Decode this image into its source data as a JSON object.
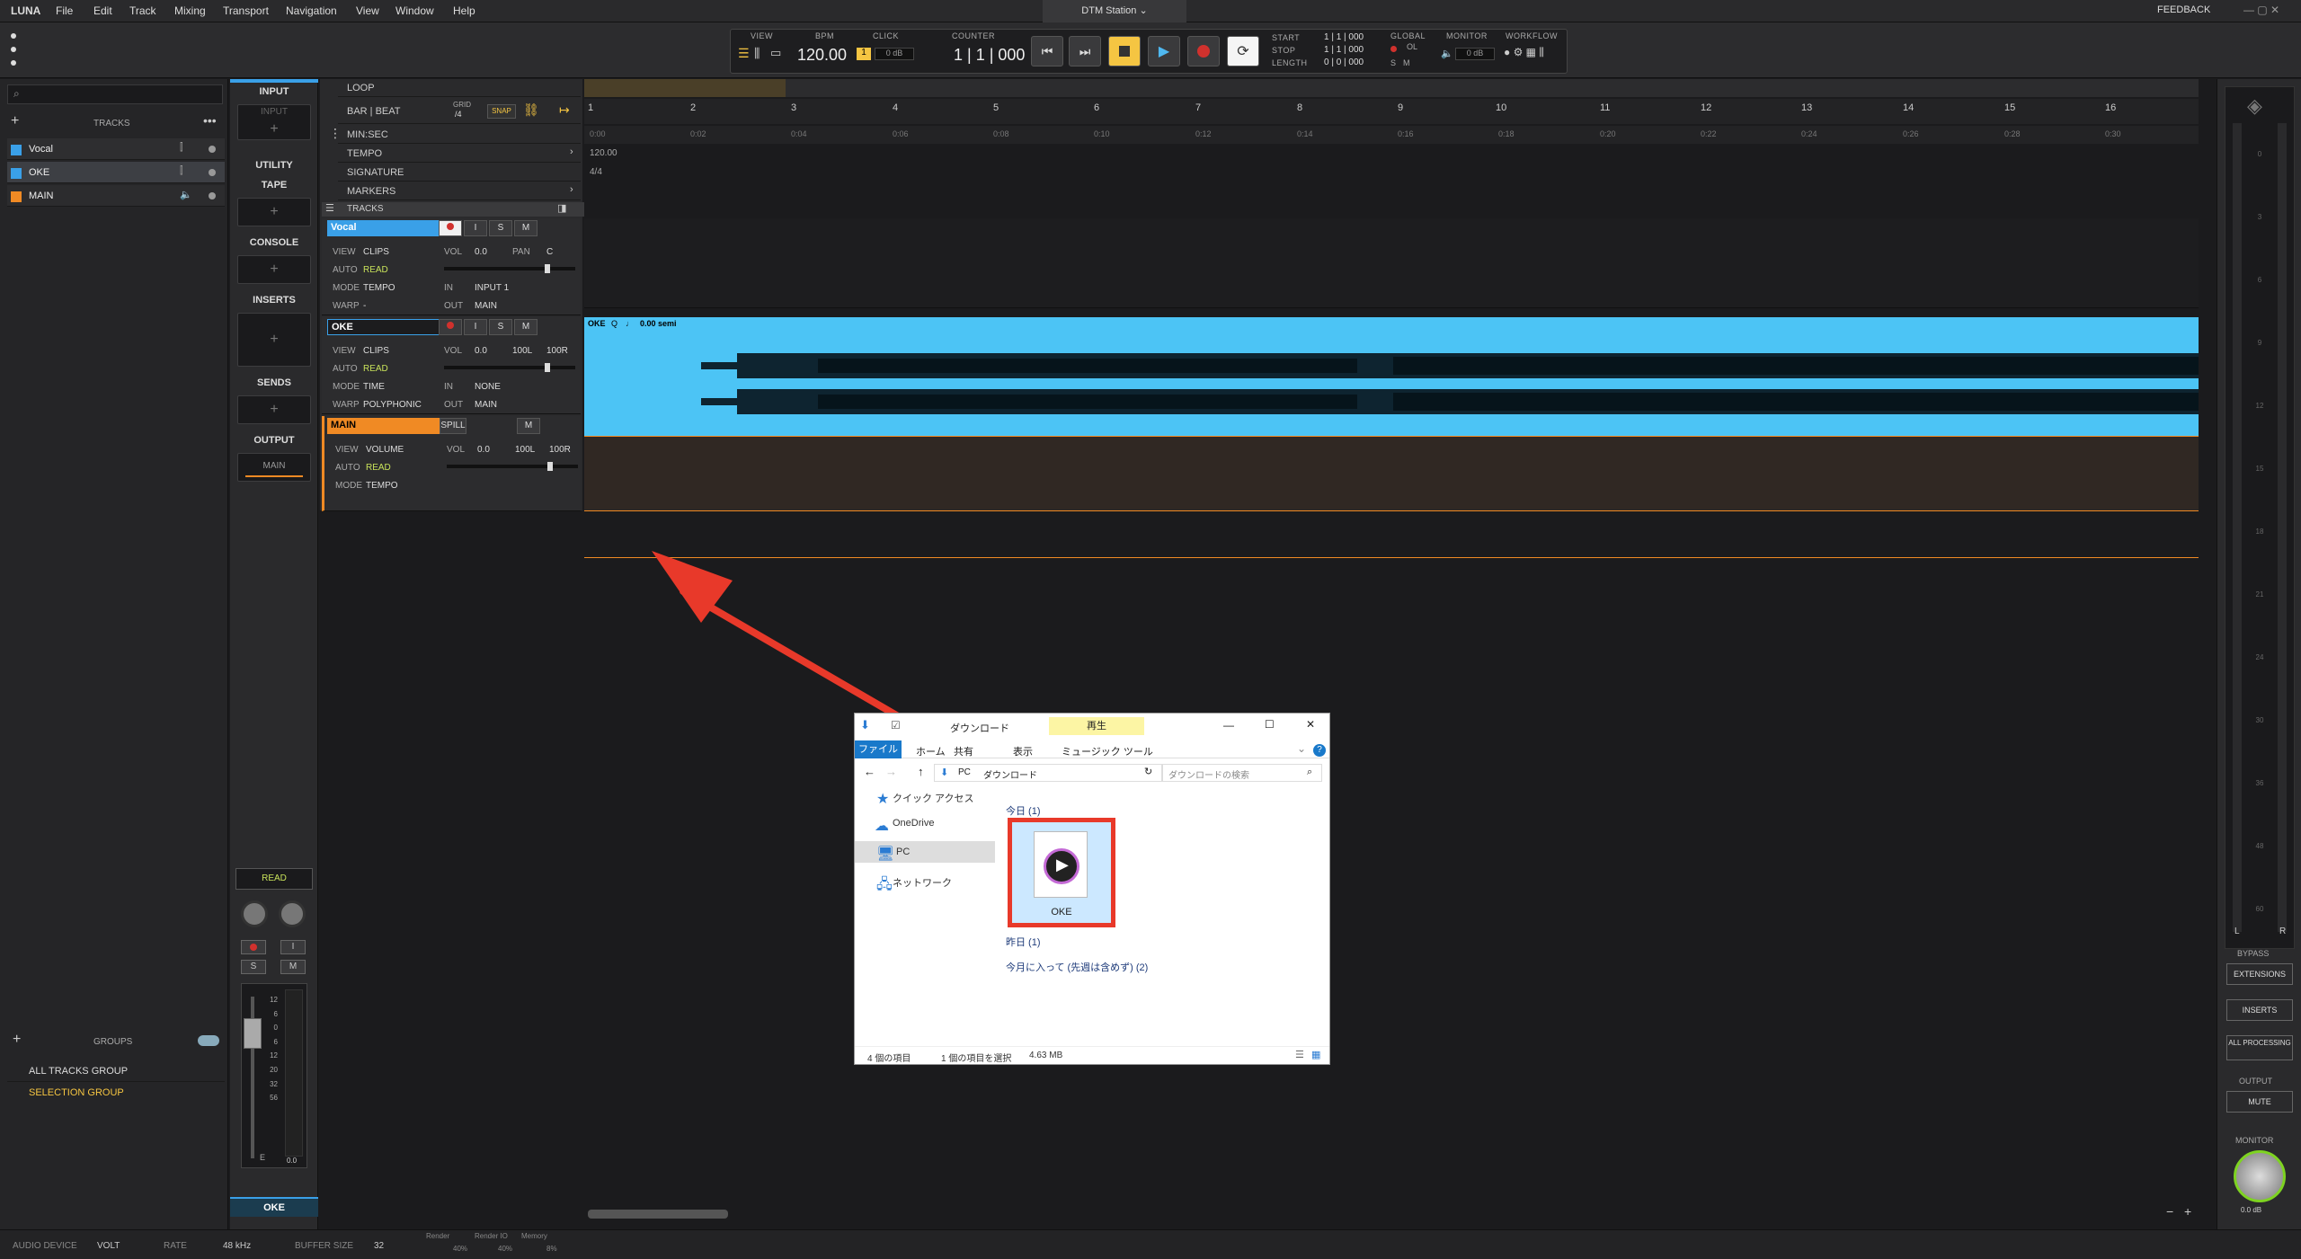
{
  "menubar": {
    "items": [
      "LUNA",
      "File",
      "Edit",
      "Track",
      "Mixing",
      "Transport",
      "Navigation",
      "View",
      "Window",
      "Help"
    ],
    "session": "DTM Station",
    "feedback": "FEEDBACK"
  },
  "transport": {
    "view": "VIEW",
    "bpm_label": "BPM",
    "bpm": "120.00",
    "click_label": "CLICK",
    "click_level": "0 dB",
    "counter_label": "COUNTER",
    "counter": "1 | 1 | 000",
    "start_label": "START",
    "stop_label": "STOP",
    "length_label": "LENGTH",
    "start_val": "1 | 1 | 000",
    "stop_val": "1 | 1 | 000",
    "length_val": "0 | 0 | 000",
    "global_label": "GLOBAL",
    "monitor_label": "MONITOR",
    "monitor_level": "0 dB",
    "workflow_label": "WORKFLOW",
    "ol": "OL",
    "s": "S",
    "m": "M"
  },
  "left": {
    "tracks_header": "TRACKS",
    "tracks": [
      {
        "name": "Vocal",
        "color": "#3aa0e8"
      },
      {
        "name": "OKE",
        "color": "#3aa0e8"
      },
      {
        "name": "MAIN",
        "color": "#f08a24"
      }
    ],
    "groups_header": "GROUPS",
    "groups": [
      "ALL TRACKS GROUP",
      "SELECTION GROUP"
    ]
  },
  "strip": {
    "input": "INPUT",
    "input_slot": "INPUT",
    "utility": "UTILITY",
    "tape": "TAPE",
    "console": "CONSOLE",
    "inserts": "INSERTS",
    "sends": "SENDS",
    "output": "OUTPUT",
    "output_slot": "MAIN",
    "auto": "READ",
    "name": "OKE",
    "scale": [
      "12",
      "6",
      "0",
      "6",
      "12",
      "20",
      "32",
      "56"
    ],
    "e": "E",
    "zero": "0.0"
  },
  "rulers": {
    "loop": "LOOP",
    "barbeat": "BAR | BEAT",
    "grid": "GRID",
    "grid_val": "/4",
    "snap": "SNAP",
    "minsec": "MIN:SEC",
    "tempo": "TEMPO",
    "signature": "SIGNATURE",
    "markers": "MARKERS",
    "tracks": "TRACKS",
    "tempo_val": "120.00",
    "sig_val": "4/4"
  },
  "bars": [
    "1",
    "2",
    "3",
    "4",
    "5",
    "6",
    "7",
    "8",
    "9",
    "10",
    "11",
    "12",
    "13",
    "14",
    "15",
    "16"
  ],
  "times": [
    "0:00",
    "0:02",
    "0:04",
    "0:06",
    "0:08",
    "0:10",
    "0:12",
    "0:14",
    "0:16",
    "0:18",
    "0:20",
    "0:22",
    "0:24",
    "0:26",
    "0:28",
    "0:30"
  ],
  "tracks": {
    "vocal": {
      "name": "Vocal",
      "view": "VIEW",
      "view_v": "CLIPS",
      "auto": "AUTO",
      "auto_v": "READ",
      "mode": "MODE",
      "mode_v": "TEMPO",
      "warp": "WARP",
      "warp_v": "-",
      "vol": "VOL",
      "vol_v": "0.0",
      "pan": "PAN",
      "pan_v": "C",
      "in": "IN",
      "in_v": "INPUT 1",
      "out": "OUT",
      "out_v": "MAIN"
    },
    "oke": {
      "name": "OKE",
      "view": "VIEW",
      "view_v": "CLIPS",
      "auto": "AUTO",
      "auto_v": "READ",
      "mode": "MODE",
      "mode_v": "TIME",
      "warp": "WARP",
      "warp_v": "POLYPHONIC",
      "vol": "VOL",
      "vol_v": "0.0",
      "l": "100L",
      "r": "100R",
      "in": "IN",
      "in_v": "NONE",
      "out": "OUT",
      "out_v": "MAIN",
      "clip": "OKE",
      "clip_q": "Q",
      "clip_semi": "0.00 semi"
    },
    "main": {
      "name": "MAIN",
      "spill": "SPILL",
      "view": "VIEW",
      "view_v": "VOLUME",
      "auto": "AUTO",
      "auto_v": "READ",
      "mode": "MODE",
      "mode_v": "TEMPO",
      "vol": "VOL",
      "vol_v": "0.0",
      "l": "100L",
      "r": "100R"
    },
    "buttons": {
      "i": "I",
      "s": "S",
      "m": "M"
    }
  },
  "right": {
    "meter_scale": [
      "0",
      "3",
      "6",
      "9",
      "12",
      "15",
      "18",
      "21",
      "24",
      "30",
      "36",
      "48",
      "60"
    ],
    "l": "L",
    "r": "R",
    "bypass": "BYPASS",
    "extensions": "EXTENSIONS",
    "inserts": "INSERTS",
    "all_processing": "ALL PROCESSING",
    "output": "OUTPUT",
    "mute": "MUTE",
    "monitor": "MONITOR",
    "monitor_db": "0.0 dB"
  },
  "status": {
    "audio_device_label": "AUDIO DEVICE",
    "audio_device": "VOLT",
    "rate_label": "RATE",
    "rate": "48 kHz",
    "buffer_label": "BUFFER SIZE",
    "buffer": "32",
    "render": "Render",
    "render_v": "40%",
    "renderio": "Render IO",
    "renderio_v": "40%",
    "memory": "Memory",
    "memory_v": "8%"
  },
  "explorer": {
    "title": "ダウンロード",
    "play_tab": "再生",
    "file": "ファイル",
    "home": "ホーム",
    "share": "共有",
    "view": "表示",
    "music": "ミュージック ツール",
    "path_pc": "PC",
    "path_dl": "ダウンロード",
    "search": "ダウンロードの検索",
    "nav": [
      "クイック アクセス",
      "OneDrive",
      "PC",
      "ネットワーク"
    ],
    "today": "今日 (1)",
    "yesterday": "昨日 (1)",
    "thismonth": "今月に入って (先週は含めず) (2)",
    "file_name": "OKE",
    "status1": "4 個の項目",
    "status2": "1 個の項目を選択",
    "status3": "4.63 MB"
  }
}
